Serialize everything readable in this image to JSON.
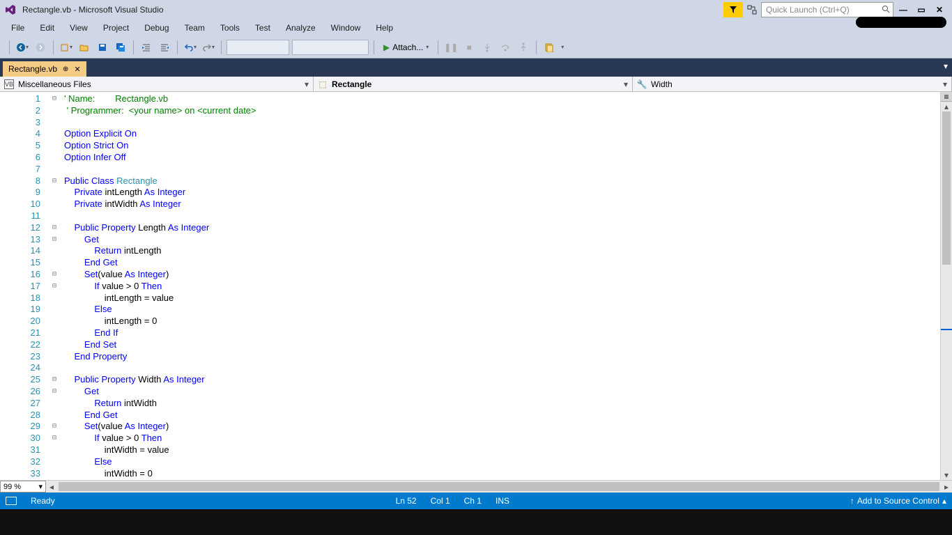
{
  "title": "Rectangle.vb - Microsoft Visual Studio",
  "quick_launch_placeholder": "Quick Launch (Ctrl+Q)",
  "menu": [
    "File",
    "Edit",
    "View",
    "Project",
    "Debug",
    "Team",
    "Tools",
    "Test",
    "Analyze",
    "Window",
    "Help"
  ],
  "toolbar": {
    "attach": "Attach..."
  },
  "tab": {
    "name": "Rectangle.vb"
  },
  "nav": {
    "project": "Miscellaneous Files",
    "class": "Rectangle",
    "member": "Width"
  },
  "zoom": "99 %",
  "status": {
    "ready": "Ready",
    "ln": "Ln 52",
    "col": "Col 1",
    "ch": "Ch 1",
    "ins": "INS",
    "src": "Add to Source Control"
  },
  "code": [
    {
      "n": 1,
      "f": "⊟",
      "seg": [
        {
          "c": "c",
          "t": "' "
        },
        {
          "c": "c",
          "t": "Name:        "
        },
        {
          "c": "c",
          "t": "Rectangle.vb"
        }
      ]
    },
    {
      "n": 2,
      "f": "",
      "seg": [
        {
          "c": "c",
          "t": " ' Programmer:  <your name> on <current date>"
        }
      ]
    },
    {
      "n": 3,
      "f": "",
      "seg": []
    },
    {
      "n": 4,
      "f": "",
      "seg": [
        {
          "c": "k",
          "t": "Option Explicit On"
        }
      ]
    },
    {
      "n": 5,
      "f": "",
      "seg": [
        {
          "c": "k",
          "t": "Option Strict On"
        }
      ]
    },
    {
      "n": 6,
      "f": "",
      "seg": [
        {
          "c": "k",
          "t": "Option Infer Off"
        }
      ]
    },
    {
      "n": 7,
      "f": "",
      "seg": []
    },
    {
      "n": 8,
      "f": "⊟",
      "seg": [
        {
          "c": "k",
          "t": "Public Class"
        },
        {
          "c": "",
          "t": " "
        },
        {
          "c": "t",
          "t": "Rectangle"
        }
      ]
    },
    {
      "n": 9,
      "f": "",
      "seg": [
        {
          "c": "",
          "t": "    "
        },
        {
          "c": "k",
          "t": "Private"
        },
        {
          "c": "",
          "t": " intLength "
        },
        {
          "c": "k",
          "t": "As Integer"
        }
      ]
    },
    {
      "n": 10,
      "f": "",
      "seg": [
        {
          "c": "",
          "t": "    "
        },
        {
          "c": "k",
          "t": "Private"
        },
        {
          "c": "",
          "t": " intWidth "
        },
        {
          "c": "k",
          "t": "As Integer"
        }
      ]
    },
    {
      "n": 11,
      "f": "",
      "seg": []
    },
    {
      "n": 12,
      "f": "⊟",
      "seg": [
        {
          "c": "",
          "t": "    "
        },
        {
          "c": "k",
          "t": "Public Property"
        },
        {
          "c": "",
          "t": " Length "
        },
        {
          "c": "k",
          "t": "As Integer"
        }
      ]
    },
    {
      "n": 13,
      "f": "⊟",
      "seg": [
        {
          "c": "",
          "t": "        "
        },
        {
          "c": "k",
          "t": "Get"
        }
      ]
    },
    {
      "n": 14,
      "f": "",
      "seg": [
        {
          "c": "",
          "t": "            "
        },
        {
          "c": "k",
          "t": "Return"
        },
        {
          "c": "",
          "t": " intLength"
        }
      ]
    },
    {
      "n": 15,
      "f": "",
      "seg": [
        {
          "c": "",
          "t": "        "
        },
        {
          "c": "k",
          "t": "End Get"
        }
      ]
    },
    {
      "n": 16,
      "f": "⊟",
      "seg": [
        {
          "c": "",
          "t": "        "
        },
        {
          "c": "k",
          "t": "Set"
        },
        {
          "c": "",
          "t": "(value "
        },
        {
          "c": "k",
          "t": "As Integer"
        },
        {
          "c": "",
          "t": ")"
        }
      ]
    },
    {
      "n": 17,
      "f": "⊟",
      "seg": [
        {
          "c": "",
          "t": "            "
        },
        {
          "c": "k",
          "t": "If"
        },
        {
          "c": "",
          "t": " value > 0 "
        },
        {
          "c": "k",
          "t": "Then"
        }
      ]
    },
    {
      "n": 18,
      "f": "",
      "seg": [
        {
          "c": "",
          "t": "                intLength = value"
        }
      ]
    },
    {
      "n": 19,
      "f": "",
      "seg": [
        {
          "c": "",
          "t": "            "
        },
        {
          "c": "k",
          "t": "Else"
        }
      ]
    },
    {
      "n": 20,
      "f": "",
      "seg": [
        {
          "c": "",
          "t": "                intLength = 0"
        }
      ]
    },
    {
      "n": 21,
      "f": "",
      "seg": [
        {
          "c": "",
          "t": "            "
        },
        {
          "c": "k",
          "t": "End If"
        }
      ]
    },
    {
      "n": 22,
      "f": "",
      "seg": [
        {
          "c": "",
          "t": "        "
        },
        {
          "c": "k",
          "t": "End Set"
        }
      ]
    },
    {
      "n": 23,
      "f": "",
      "seg": [
        {
          "c": "",
          "t": "    "
        },
        {
          "c": "k",
          "t": "End Property"
        }
      ]
    },
    {
      "n": 24,
      "f": "",
      "seg": []
    },
    {
      "n": 25,
      "f": "⊟",
      "seg": [
        {
          "c": "",
          "t": "    "
        },
        {
          "c": "k",
          "t": "Public Property"
        },
        {
          "c": "",
          "t": " Width "
        },
        {
          "c": "k",
          "t": "As Integer"
        }
      ]
    },
    {
      "n": 26,
      "f": "⊟",
      "seg": [
        {
          "c": "",
          "t": "        "
        },
        {
          "c": "k",
          "t": "Get"
        }
      ]
    },
    {
      "n": 27,
      "f": "",
      "seg": [
        {
          "c": "",
          "t": "            "
        },
        {
          "c": "k",
          "t": "Return"
        },
        {
          "c": "",
          "t": " intWidth"
        }
      ]
    },
    {
      "n": 28,
      "f": "",
      "seg": [
        {
          "c": "",
          "t": "        "
        },
        {
          "c": "k",
          "t": "End Get"
        }
      ]
    },
    {
      "n": 29,
      "f": "⊟",
      "seg": [
        {
          "c": "",
          "t": "        "
        },
        {
          "c": "k",
          "t": "Set"
        },
        {
          "c": "",
          "t": "(value "
        },
        {
          "c": "k",
          "t": "As Integer"
        },
        {
          "c": "",
          "t": ")"
        }
      ]
    },
    {
      "n": 30,
      "f": "⊟",
      "seg": [
        {
          "c": "",
          "t": "            "
        },
        {
          "c": "k",
          "t": "If"
        },
        {
          "c": "",
          "t": " value > 0 "
        },
        {
          "c": "k",
          "t": "Then"
        }
      ]
    },
    {
      "n": 31,
      "f": "",
      "seg": [
        {
          "c": "",
          "t": "                intWidth = value"
        }
      ]
    },
    {
      "n": 32,
      "f": "",
      "seg": [
        {
          "c": "",
          "t": "            "
        },
        {
          "c": "k",
          "t": "Else"
        }
      ]
    },
    {
      "n": 33,
      "f": "",
      "seg": [
        {
          "c": "",
          "t": "                intWidth = 0"
        }
      ]
    }
  ]
}
